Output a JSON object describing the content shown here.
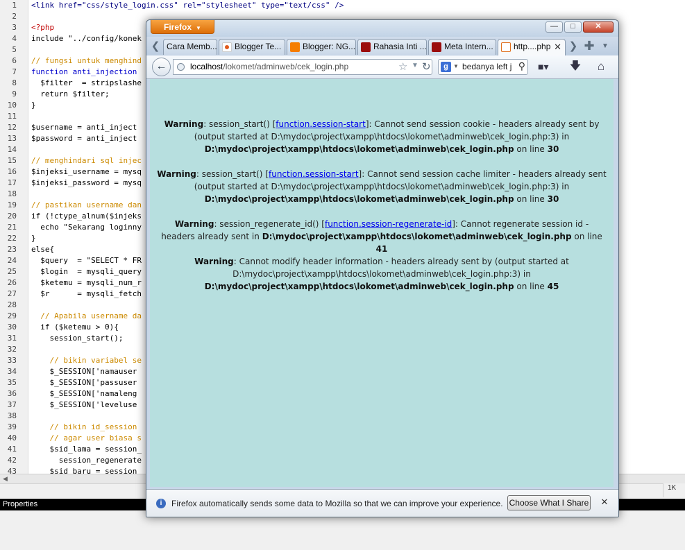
{
  "editor": {
    "lines": [
      {
        "n": "1",
        "text": "<link href=\"css/style_login.css\" rel=\"stylesheet\" type=\"text/css\" />",
        "kind": "html"
      },
      {
        "n": "2",
        "text": "",
        "kind": "def"
      },
      {
        "n": "3",
        "text": "<?php",
        "kind": "php"
      },
      {
        "n": "4",
        "text": "include \"../config/konek",
        "kind": "def"
      },
      {
        "n": "5",
        "text": "",
        "kind": "def"
      },
      {
        "n": "6",
        "text": "// fungsi untuk menghind",
        "kind": "cm"
      },
      {
        "n": "7",
        "text": "function anti_injection",
        "kind": "kw"
      },
      {
        "n": "8",
        "text": "  $filter  = stripslashe",
        "kind": "def"
      },
      {
        "n": "9",
        "text": "  return $filter;",
        "kind": "def"
      },
      {
        "n": "10",
        "text": "}",
        "kind": "def"
      },
      {
        "n": "11",
        "text": "",
        "kind": "def"
      },
      {
        "n": "12",
        "text": "$username = anti_inject",
        "kind": "def"
      },
      {
        "n": "13",
        "text": "$password = anti_inject",
        "kind": "def"
      },
      {
        "n": "14",
        "text": "",
        "kind": "def"
      },
      {
        "n": "15",
        "text": "// menghindari sql injec",
        "kind": "cm"
      },
      {
        "n": "16",
        "text": "$injeksi_username = mysq",
        "kind": "def"
      },
      {
        "n": "17",
        "text": "$injeksi_password = mysq",
        "kind": "def"
      },
      {
        "n": "18",
        "text": "",
        "kind": "def"
      },
      {
        "n": "19",
        "text": "// pastikan username dan",
        "kind": "cm"
      },
      {
        "n": "20",
        "text": "if (!ctype_alnum($injeks",
        "kind": "def"
      },
      {
        "n": "21",
        "text": "  echo \"Sekarang loginny",
        "kind": "def"
      },
      {
        "n": "22",
        "text": "}",
        "kind": "def"
      },
      {
        "n": "23",
        "text": "else{",
        "kind": "def"
      },
      {
        "n": "24",
        "text": "  $query  = \"SELECT * FR",
        "kind": "def"
      },
      {
        "n": "25",
        "text": "  $login  = mysqli_query",
        "kind": "def"
      },
      {
        "n": "26",
        "text": "  $ketemu = mysqli_num_r",
        "kind": "def"
      },
      {
        "n": "27",
        "text": "  $r      = mysqli_fetch",
        "kind": "def"
      },
      {
        "n": "28",
        "text": "",
        "kind": "def"
      },
      {
        "n": "29",
        "text": "  // Apabila username da",
        "kind": "cm"
      },
      {
        "n": "30",
        "text": "  if ($ketemu > 0){",
        "kind": "def"
      },
      {
        "n": "31",
        "text": "    session_start();",
        "kind": "def"
      },
      {
        "n": "32",
        "text": "",
        "kind": "def"
      },
      {
        "n": "33",
        "text": "    // bikin variabel se",
        "kind": "cm"
      },
      {
        "n": "34",
        "text": "    $_SESSION['namauser",
        "kind": "def"
      },
      {
        "n": "35",
        "text": "    $_SESSION['passuser",
        "kind": "def"
      },
      {
        "n": "36",
        "text": "    $_SESSION['namaleng",
        "kind": "def"
      },
      {
        "n": "37",
        "text": "    $_SESSION['leveluse",
        "kind": "def"
      },
      {
        "n": "38",
        "text": "",
        "kind": "def"
      },
      {
        "n": "39",
        "text": "    // bikin id_session",
        "kind": "cm"
      },
      {
        "n": "40",
        "text": "    // agar user biasa s",
        "kind": "cm"
      },
      {
        "n": "41",
        "text": "    $sid_lama = session_",
        "kind": "def"
      },
      {
        "n": "42",
        "text": "      session_regenerate",
        "kind": "def"
      },
      {
        "n": "43",
        "text": "    $sid_baru = session_",
        "kind": "def"
      }
    ],
    "status_right": "1K",
    "properties_label": "Properties"
  },
  "firefox": {
    "menu_button": "Firefox",
    "tabs": [
      {
        "label": "Cara Memb...",
        "icon": "none"
      },
      {
        "label": "Blogger Te...",
        "icon": "blogger-icon"
      },
      {
        "label": "Blogger: NG...",
        "icon": "blogger-icon"
      },
      {
        "label": "Rahasia Inti ...",
        "icon": "site-icon"
      },
      {
        "label": "Meta Intern...",
        "icon": "site-icon"
      },
      {
        "label": "http....php",
        "icon": "xampp-icon",
        "active": true
      }
    ],
    "url_host": "localhost",
    "url_path": "/lokomet/adminweb/cek_login.php",
    "search_text": "bedanya left j",
    "warnings": [
      {
        "label": "Warning",
        "pre": ": session_start() [",
        "link": "function.session-start",
        "mid": "]: Cannot send session cookie - headers already sent by (output started at D:\\mydoc\\project\\xampp\\htdocs\\lokomet\\adminweb\\cek_login.php:3) in ",
        "file": "D:\\mydoc\\project\\xampp\\htdocs\\lokomet\\adminweb\\cek_login.php",
        "online": " on line ",
        "line": "30"
      },
      {
        "label": "Warning",
        "pre": ": session_start() [",
        "link": "function.session-start",
        "mid": "]: Cannot send session cache limiter - headers already sent (output started at D:\\mydoc\\project\\xampp\\htdocs\\lokomet\\adminweb\\cek_login.php:3) in ",
        "file": "D:\\mydoc\\project\\xampp\\htdocs\\lokomet\\adminweb\\cek_login.php",
        "online": " on line ",
        "line": "30"
      },
      {
        "label": "Warning",
        "pre": ": session_regenerate_id() [",
        "link": "function.session-regenerate-id",
        "mid": "]: Cannot regenerate session id - headers already sent in ",
        "file": "D:\\mydoc\\project\\xampp\\htdocs\\lokomet\\adminweb\\cek_login.php",
        "online": " on line ",
        "line": "41"
      },
      {
        "label": "Warning",
        "pre": ": Cannot modify header information - headers already sent by (output started at D:\\mydoc\\project\\xampp\\htdocs\\lokomet\\adminweb\\cek_login.php:3) in ",
        "link": "",
        "mid": "",
        "file": "D:\\mydoc\\project\\xampp\\htdocs\\lokomet\\adminweb\\cek_login.php",
        "online": " on line ",
        "line": "45"
      }
    ],
    "notification_text": "Firefox automatically sends some data to Mozilla so that we can improve your experience.",
    "notification_button": "Choose What I Share",
    "content_bg": "#b7dfdf"
  }
}
